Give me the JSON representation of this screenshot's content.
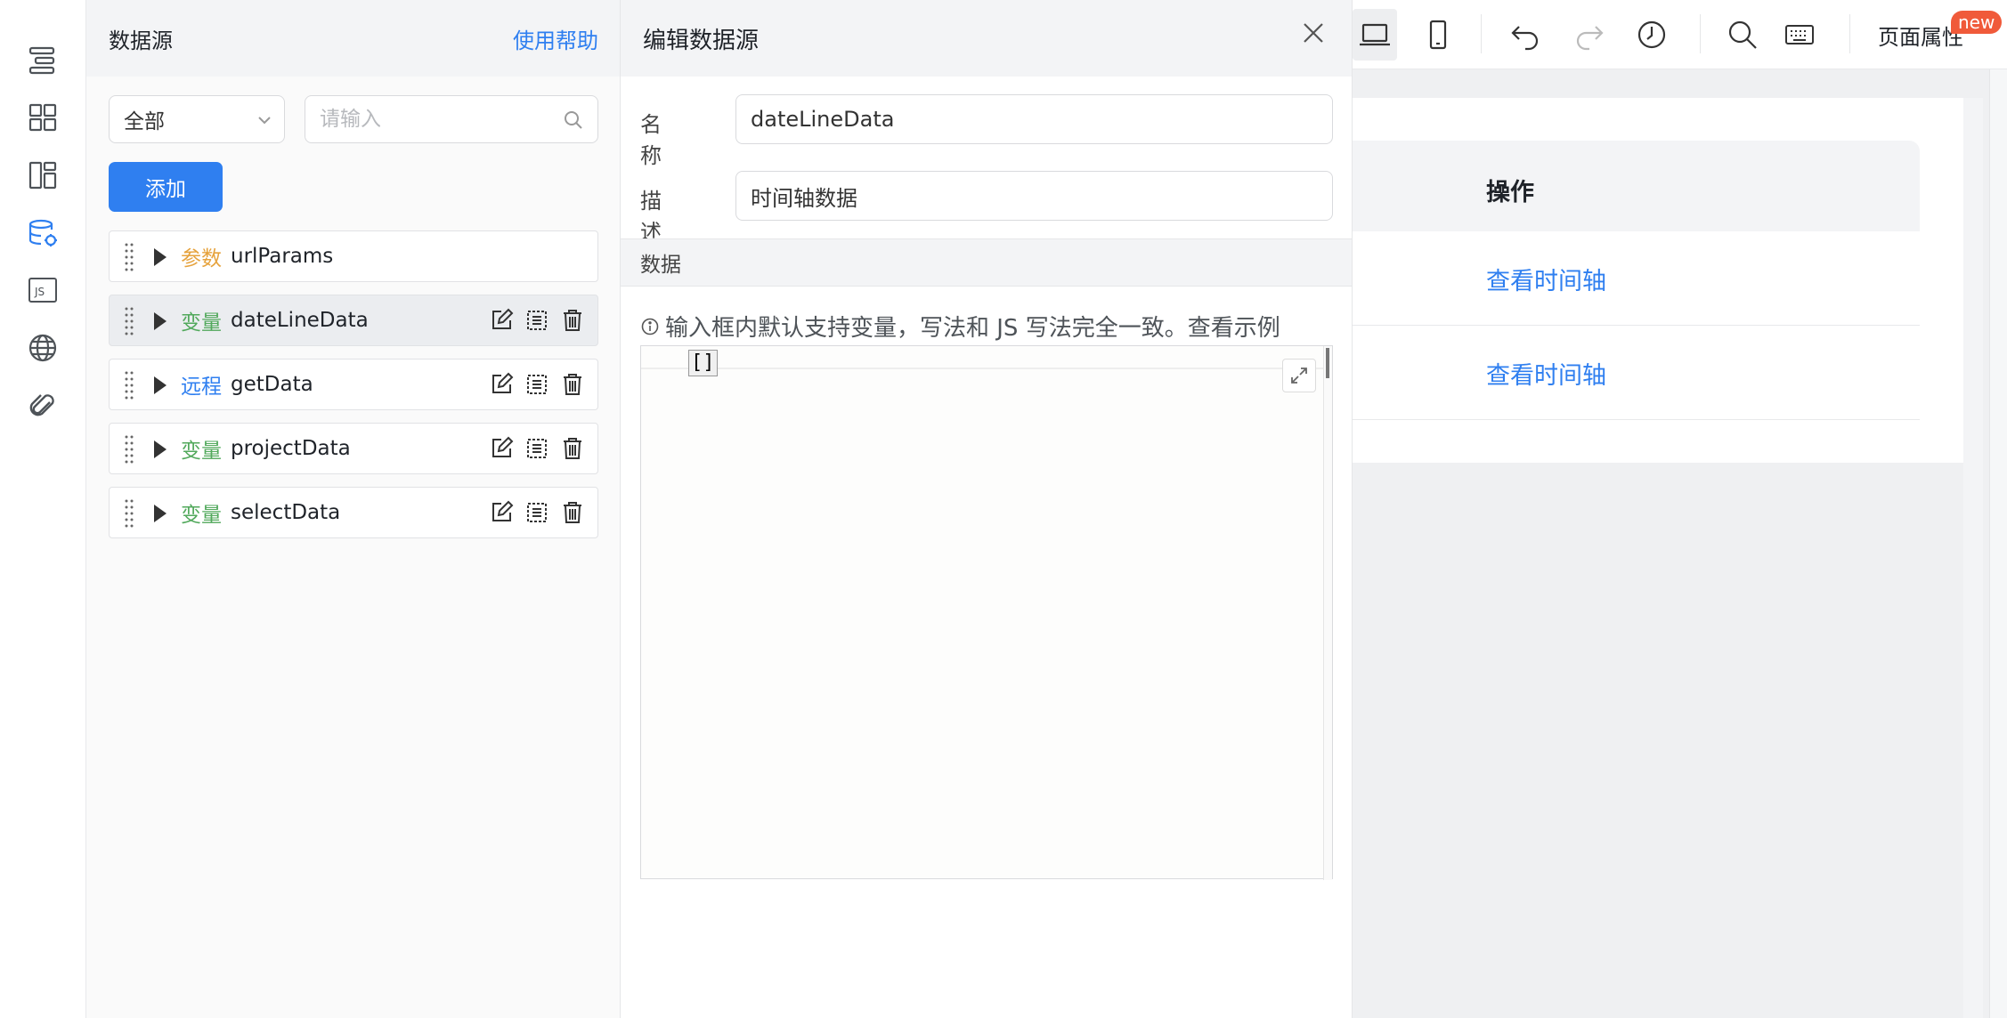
{
  "rail": {
    "icons": [
      "outline-icon",
      "components-icon",
      "layout-icon",
      "datasource-icon",
      "js-icon",
      "globe-icon",
      "attachment-icon"
    ],
    "js_label": "JS"
  },
  "datasource_panel": {
    "title": "数据源",
    "help_link": "使用帮助",
    "filter_select": "全部",
    "search_placeholder": "请输入",
    "add_button": "添加",
    "items": [
      {
        "type": "参数",
        "type_color": "#e6a23c",
        "name": "urlParams",
        "has_actions": false,
        "active": false
      },
      {
        "type": "变量",
        "type_color": "#52a95c",
        "name": "dateLineData",
        "has_actions": true,
        "active": true
      },
      {
        "type": "远程",
        "type_color": "#2f7ff0",
        "name": "getData",
        "has_actions": true,
        "active": false
      },
      {
        "type": "变量",
        "type_color": "#52a95c",
        "name": "projectData",
        "has_actions": true,
        "active": false
      },
      {
        "type": "变量",
        "type_color": "#52a95c",
        "name": "selectData",
        "has_actions": true,
        "active": false
      }
    ]
  },
  "edit_panel": {
    "title": "编辑数据源",
    "name_label": "名称",
    "name_value": "dateLineData",
    "desc_label": "描述",
    "desc_value": "时间轴数据",
    "section_title": "数据",
    "hint": "输入框内默认支持变量，写法和 JS 写法完全一致。查看示例",
    "editor_code": "[]"
  },
  "canvas": {
    "page_props": "页面属性",
    "new_badge": "new",
    "table": {
      "column_header": "操作",
      "rows": [
        "查看时间轴",
        "查看时间轴"
      ]
    }
  },
  "colors": {
    "accent": "#2f7ff0",
    "badge": "#f05a3a"
  }
}
